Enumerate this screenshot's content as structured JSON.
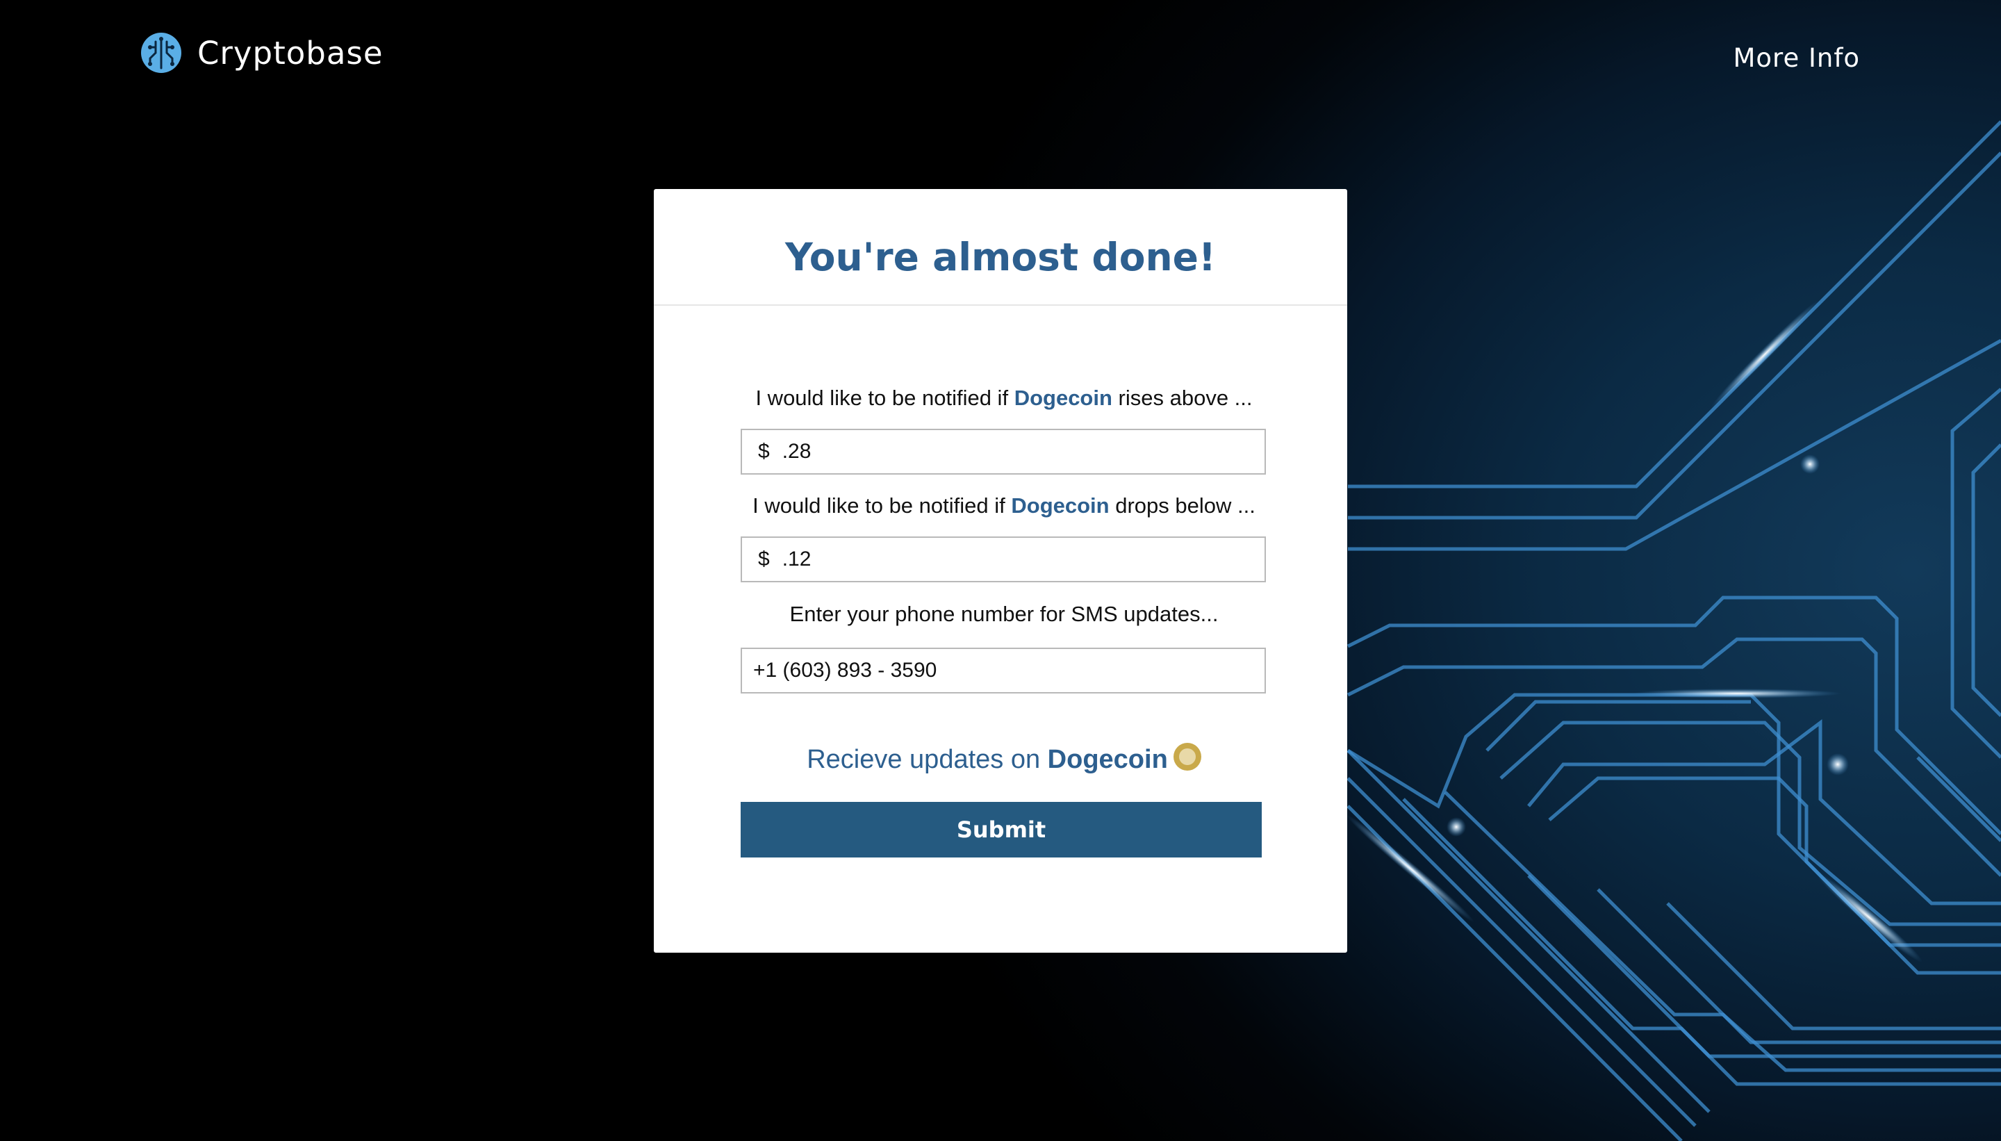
{
  "header": {
    "brand_name": "Cryptobase",
    "logo_icon": "circuit-brain-icon",
    "more_info": "More Info"
  },
  "card": {
    "title": "You're almost done!",
    "rise_label": {
      "before": "I would like to be notified if",
      "coin": "Dogecoin",
      "after": "rises above ..."
    },
    "rise_field": {
      "prefix": "$",
      "value": ".28"
    },
    "drop_label": {
      "before": "I would like to be notified if",
      "coin": "Dogecoin",
      "after": "drops below ..."
    },
    "drop_field": {
      "prefix": "$",
      "value": ".12"
    },
    "phone_label": "Enter your phone number for SMS updates...",
    "phone_field": {
      "value": "+1 (603) 893 - 3590"
    },
    "receive": {
      "text": "Recieve updates on",
      "coin": "Dogecoin",
      "icon": "dogecoin-icon"
    },
    "submit_label": "Submit"
  },
  "colors": {
    "accent": "#2d5f8f",
    "button": "#255a80",
    "background": "#000000",
    "circuit": "#3f8fd0"
  }
}
